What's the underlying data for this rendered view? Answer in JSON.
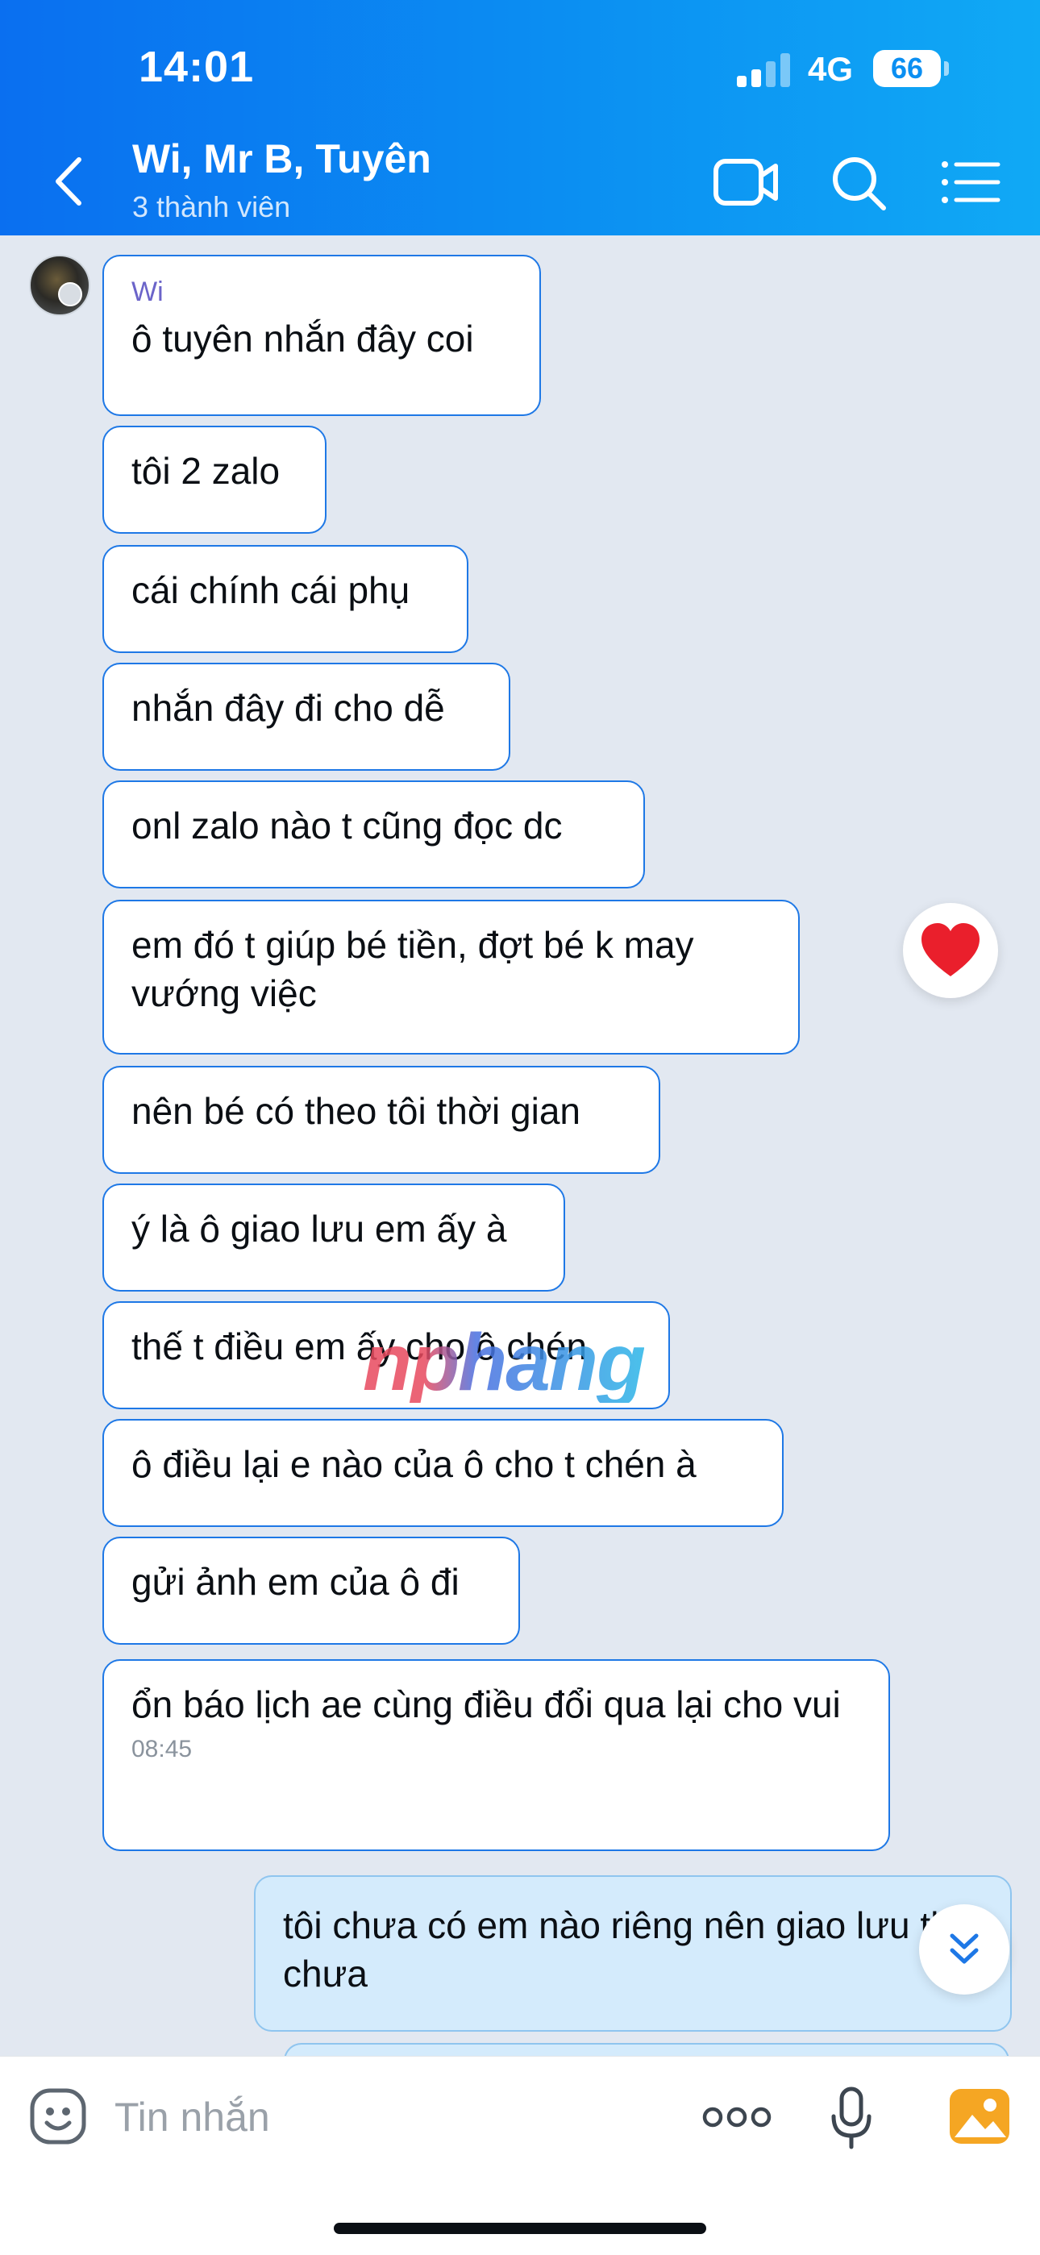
{
  "status_bar": {
    "time": "14:01",
    "network": "4G",
    "battery": "66"
  },
  "header": {
    "title": "Wi, Mr B, Tuyên",
    "subtitle": "3 thành viên",
    "colors": {
      "gradient_start": "#0a6ff0",
      "gradient_end": "#10a9f5"
    },
    "icons": [
      "chevron-left-icon",
      "video-call-icon",
      "search-icon",
      "list-icon"
    ]
  },
  "chat": {
    "sender": "Wi",
    "messages": [
      {
        "text": "ô tuyên nhắn đây coi"
      },
      {
        "text": "tôi 2 zalo"
      },
      {
        "text": "cái chính cái phụ"
      },
      {
        "text": "nhắn đây đi cho dễ"
      },
      {
        "text": "onl zalo nào t cũng đọc dc"
      },
      {
        "text": "em đó t giúp bé tiền, đợt bé k may vướng việc",
        "reaction": "heart"
      },
      {
        "text": "nên bé có theo tôi thời gian"
      },
      {
        "text": "ý là ô giao lưu em ấy à"
      },
      {
        "text": "thế t điều em ấy cho ô chén"
      },
      {
        "text": "ô điều lại e nào của ô cho t chén à"
      },
      {
        "text": "gửi ảnh em của ô đi"
      },
      {
        "text": "ổn báo lịch ae cùng điều đổi qua lại cho vui",
        "time": "08:45"
      }
    ],
    "my_messages": [
      {
        "text": "tôi chưa có em nào riêng nên giao lưu thì chưa"
      }
    ],
    "watermark": "nphang"
  },
  "input_bar": {
    "placeholder": "Tin nhắn",
    "icons": [
      "emoji-icon",
      "more-dots-icon",
      "microphone-icon",
      "image-icon"
    ]
  }
}
